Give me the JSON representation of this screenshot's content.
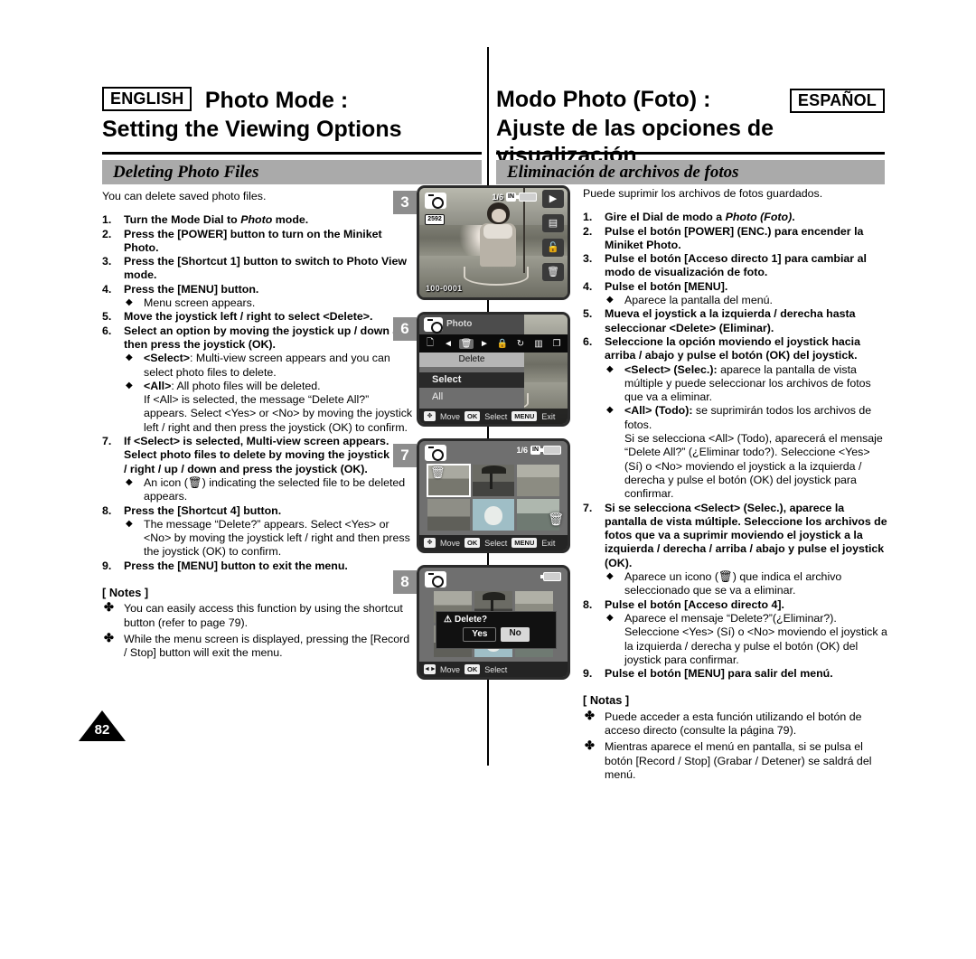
{
  "header": {
    "english_tag": "ENGLISH",
    "spanish_tag": "ESPAÑOL",
    "en_title_line1": "Photo Mode :",
    "en_title_line2": "Setting the Viewing Options",
    "es_title_line1": "Modo Photo (Foto) :",
    "es_title_line2": "Ajuste de las opciones de visualización"
  },
  "section": {
    "en": "Deleting Photo Files",
    "es": "Eliminación de archivos de fotos"
  },
  "english": {
    "intro": "You can delete saved photo files.",
    "steps": [
      {
        "num": "1.",
        "text": "Turn the Mode Dial to Photo mode.",
        "pre": "Turn the Mode Dial to ",
        "ital": "Photo",
        "post": " mode."
      },
      {
        "num": "2.",
        "text": "Press the [POWER] button to turn on the Miniket Photo."
      },
      {
        "num": "3.",
        "text": "Press the [Shortcut 1] button to switch to Photo View mode."
      },
      {
        "num": "4.",
        "text": "Press the [MENU] button."
      },
      {
        "num": "5.",
        "text": "Move the joystick left / right to select <Delete>."
      },
      {
        "num": "6.",
        "text": "Select an option by moving the joystick up / down and then press the joystick (OK)."
      },
      {
        "num": "7.",
        "text": "If <Select> is selected, Multi-view screen appears. Select photo files to delete by moving the joystick left / right / up / down and press the joystick (OK)."
      },
      {
        "num": "8.",
        "text": "Press the [Shortcut 4] button."
      },
      {
        "num": "9.",
        "text": "Press the [MENU] button to exit the menu."
      }
    ],
    "bullet_step4": "Menu screen appears.",
    "bullet_select_lead": "<Select>",
    "bullet_select_rest": ": Multi-view screen appears and you can select photo files to delete.",
    "bullet_all_lead": "<All>",
    "bullet_all_rest": ": All photo files will be deleted.",
    "bullet_all_cont": "If <All> is selected, the message “Delete All?” appears. Select <Yes> or <No> by moving the joystick left / right and then press the joystick (OK) to confirm.",
    "bullet_step7_a": "An icon (",
    "bullet_step7_b": ") indicating the selected file to be deleted appears.",
    "bullet_step8": "The message “Delete?” appears. Select <Yes> or <No> by moving the joystick left / right and then press the joystick (OK) to confirm.",
    "notes_heading": "[ Notes ]",
    "notes": [
      "You can easily access this function by using the shortcut button (refer to page 79).",
      "While the menu screen is displayed, pressing the [Record / Stop] button will exit the menu."
    ]
  },
  "spanish": {
    "intro": "Puede suprimir los archivos de fotos guardados.",
    "steps": [
      {
        "num": "1.",
        "pre": "Gire el Dial de modo a ",
        "ital": "Photo (Foto)",
        "post": "."
      },
      {
        "num": "2.",
        "text": "Pulse el botón [POWER] (ENC.) para encender la Miniket Photo."
      },
      {
        "num": "3.",
        "text": "Pulse el botón [Acceso directo 1] para cambiar al modo de visualización de foto."
      },
      {
        "num": "4.",
        "text": "Pulse el botón [MENU]."
      },
      {
        "num": "5.",
        "text": "Mueva el joystick a la izquierda / derecha hasta seleccionar <Delete> (Eliminar)."
      },
      {
        "num": "6.",
        "text": "Seleccione la opción moviendo el joystick hacia arriba / abajo y pulse el botón (OK) del joystick."
      },
      {
        "num": "7.",
        "text": "Si se selecciona <Select> (Selec.), aparece la pantalla de vista múltiple. Seleccione los archivos de fotos que va a suprimir moviendo el joystick a la izquierda / derecha / arriba / abajo y pulse el joystick (OK)."
      },
      {
        "num": "8.",
        "text": "Pulse el botón [Acceso directo 4]."
      },
      {
        "num": "9.",
        "text": "Pulse el botón [MENU] para salir del menú."
      }
    ],
    "bullet_step4": "Aparece la pantalla del menú.",
    "bullet_select_lead": "<Select> (Selec.):",
    "bullet_select_rest": " aparece la pantalla de vista múltiple y puede seleccionar los archivos de fotos que va a eliminar.",
    "bullet_all_lead": "<All> (Todo):",
    "bullet_all_rest": " se suprimirán todos los archivos de fotos.",
    "bullet_all_cont": "Si se selecciona <All> (Todo), aparecerá el mensaje “Delete All?” (¿Eliminar todo?). Seleccione <Yes> (Sí) o <No>  moviendo el joystick a la izquierda / derecha y pulse el botón (OK) del joystick para confirmar.",
    "bullet_step7_a": "Aparece un icono (",
    "bullet_step7_b": ") que indica el archivo seleccionado que se va a eliminar.",
    "bullet_step8": "Aparece el mensaje “Delete?”(¿Eliminar?). Seleccione <Yes> (Sí) o <No>  moviendo el joystick a la izquierda / derecha y pulse el botón (OK) del joystick para confirmar.",
    "notes_heading": "[ Notas ]",
    "notes": [
      "Puede acceder a esta función utilizando el botón de acceso directo (consulte la página 79).",
      "Mientras aparece el menú en pantalla, si se pulsa el botón [Record / Stop] (Grabar / Detener) se saldrá del menú."
    ]
  },
  "page_number": "82",
  "screens": [
    {
      "step": "3",
      "name": "photo-view-screen",
      "filename": "100-0001",
      "page_count": "1/6",
      "storage": "IN",
      "resolution_badge": "2592",
      "side_icons": [
        "play-icon",
        "multiview-icon",
        "lock-icon",
        "trash-icon"
      ]
    },
    {
      "step": "6",
      "name": "delete-menu-screen",
      "menu_title": "Photo",
      "menu_label": "Delete",
      "options": [
        "Select",
        "All"
      ],
      "selected_option": "Select",
      "hints": [
        {
          "key": "dpad",
          "label": "Move"
        },
        {
          "key": "OK",
          "label": "Select"
        },
        {
          "key": "MENU",
          "label": "Exit"
        }
      ]
    },
    {
      "step": "7",
      "name": "multiview-select-screen",
      "page_count": "1/6",
      "storage": "IN",
      "selected_thumb": 1,
      "hints": [
        {
          "key": "dpad",
          "label": "Move"
        },
        {
          "key": "OK",
          "label": "Select"
        },
        {
          "key": "MENU",
          "label": "Exit"
        }
      ]
    },
    {
      "step": "8",
      "name": "delete-confirm-screen",
      "dialog_title": "Delete?",
      "yes_label": "Yes",
      "no_label": "No",
      "hints": [
        {
          "key": "dpad-lr",
          "label": "Move"
        },
        {
          "key": "OK",
          "label": "Select"
        }
      ]
    }
  ],
  "glyphs": {
    "diamond": "◆",
    "club": "✤",
    "trash": "🗑",
    "warning": "⚠",
    "play": "▶",
    "lock": "🔒",
    "dpad": "✥",
    "dpad_lr": "◄►"
  }
}
